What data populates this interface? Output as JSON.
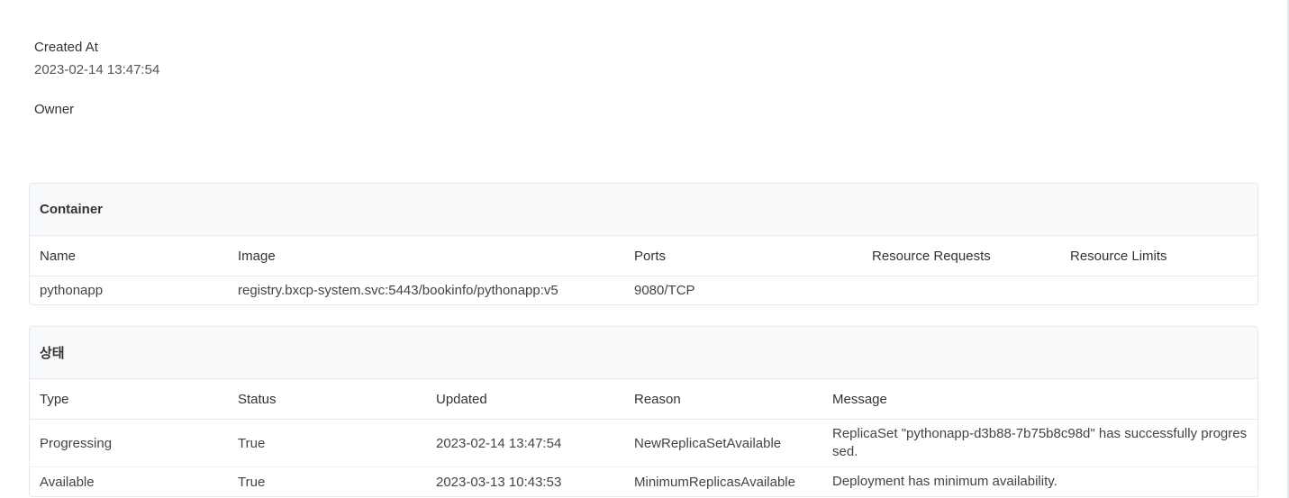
{
  "meta": {
    "created_at_label": "Created At",
    "created_at_value": "2023-02-14 13:47:54",
    "owner_label": "Owner"
  },
  "container": {
    "title": "Container",
    "columns": [
      "Name",
      "Image",
      "Ports",
      "Resource Requests",
      "Resource Limits"
    ],
    "rows": [
      {
        "name": "pythonapp",
        "image": "registry.bxcp-system.svc:5443/bookinfo/pythonapp:v5",
        "ports": "9080/TCP",
        "requests": "",
        "limits": ""
      }
    ]
  },
  "status": {
    "title": "상태",
    "columns": [
      "Type",
      "Status",
      "Updated",
      "Reason",
      "Message"
    ],
    "rows": [
      {
        "type": "Progressing",
        "status": "True",
        "updated": "2023-02-14 13:47:54",
        "reason": "NewReplicaSetAvailable",
        "message": "ReplicaSet \"pythonapp-d3b88-7b75b8c98d\" has successfully progressed."
      },
      {
        "type": "Available",
        "status": "True",
        "updated": "2023-03-13 10:43:53",
        "reason": "MinimumReplicasAvailable",
        "message": "Deployment has minimum availability."
      }
    ]
  }
}
